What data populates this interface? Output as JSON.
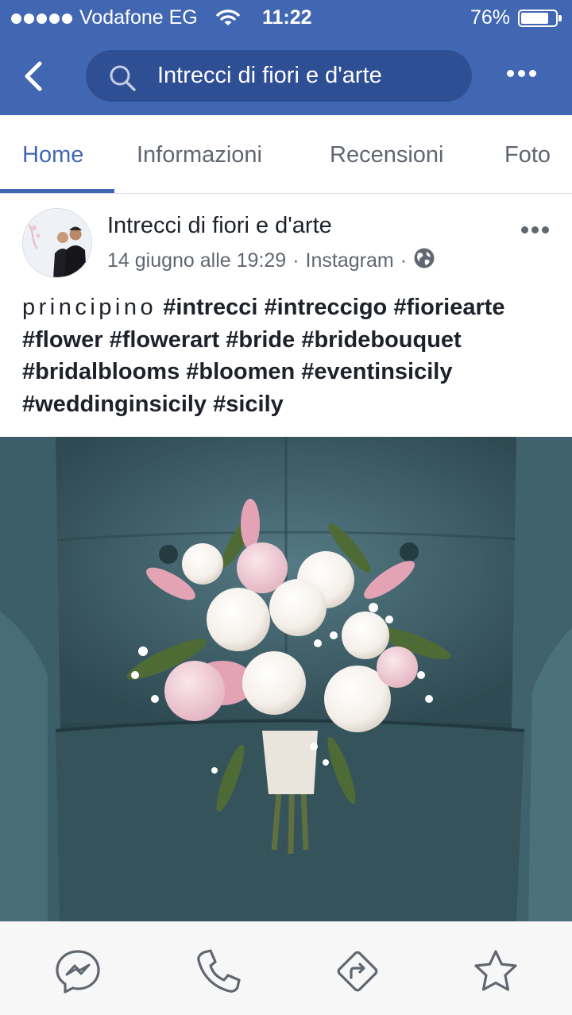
{
  "status_bar": {
    "carrier": "Vodafone EG",
    "time": "11:22",
    "battery_percent": "76%",
    "battery_level": 0.76,
    "signal_bars": 5
  },
  "header": {
    "search_value": "Intrecci di fiori e d'arte",
    "icons": [
      "back-icon",
      "search-icon",
      "more-icon"
    ]
  },
  "tabs": [
    {
      "label": "Home",
      "active": true
    },
    {
      "label": "Informazioni",
      "active": false
    },
    {
      "label": "Recensioni",
      "active": false
    },
    {
      "label": "Foto",
      "active": false
    }
  ],
  "post": {
    "page_name": "Intrecci di fiori e d'arte",
    "date": "14 giugno alle 19:29",
    "separator": "·",
    "source": "Instagram",
    "privacy_icon": "globe-icon",
    "text_lead": "principino",
    "hashtags": "#intrecci #intreccigo #fioriearte #flower #flowerart #bride #bridebouquet #bridalblooms #bloomen #eventinsicily #weddinginsicily #sicily"
  },
  "bottom_bar": {
    "icons": [
      "messenger-icon",
      "phone-icon",
      "directions-icon",
      "star-icon"
    ]
  },
  "colors": {
    "brand_blue": "#4267b2",
    "search_field": "#2f4f94",
    "tab_inactive": "#606770",
    "meta_text": "#616770"
  }
}
